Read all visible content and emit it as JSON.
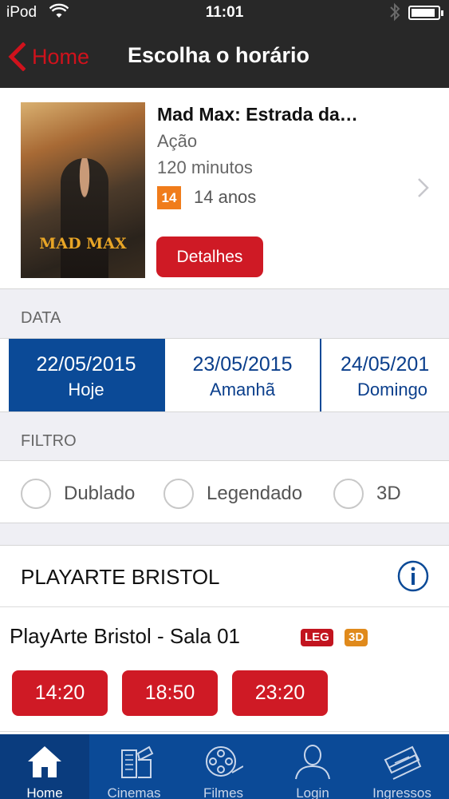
{
  "status_bar": {
    "carrier": "iPod",
    "time": "11:01",
    "battery_level": 0.92
  },
  "nav": {
    "back_label": "Home",
    "title": "Escolha o horário"
  },
  "movie": {
    "poster_title": "MAD MAX",
    "title": "Mad Max: Estrada da…",
    "genre": "Ação",
    "duration": "120 minutos",
    "rating_badge": "14",
    "rating_text": "14 anos",
    "details_label": "Detalhes"
  },
  "date_section": {
    "header": "DATA",
    "dates": [
      {
        "date": "22/05/2015",
        "label": "Hoje",
        "selected": true
      },
      {
        "date": "23/05/2015",
        "label": "Amanhã",
        "selected": false
      },
      {
        "date": "24/05/201",
        "label": "Domingo",
        "selected": false
      }
    ]
  },
  "filter_section": {
    "header": "FILTRO",
    "options": [
      "Dublado",
      "Legendado",
      "3D"
    ]
  },
  "cinema": {
    "name": "PLAYARTE BRISTOL",
    "room": "PlayArte Bristol - Sala 01",
    "tags": [
      "LEG",
      "3D"
    ],
    "times": [
      "14:20",
      "18:50",
      "23:20"
    ]
  },
  "tab_bar": {
    "tabs": [
      {
        "label": "Home",
        "icon": "home-icon",
        "active": true
      },
      {
        "label": "Cinemas",
        "icon": "ticket-clapper-icon",
        "active": false
      },
      {
        "label": "Filmes",
        "icon": "film-reel-icon",
        "active": false
      },
      {
        "label": "Login",
        "icon": "person-icon",
        "active": false
      },
      {
        "label": "Ingressos",
        "icon": "tickets-icon",
        "active": false
      }
    ]
  },
  "colors": {
    "nav_background": "#282828",
    "accent_red": "#cf1a25",
    "brand_blue": "#0b4a97",
    "rating_orange": "#f07c1b"
  }
}
